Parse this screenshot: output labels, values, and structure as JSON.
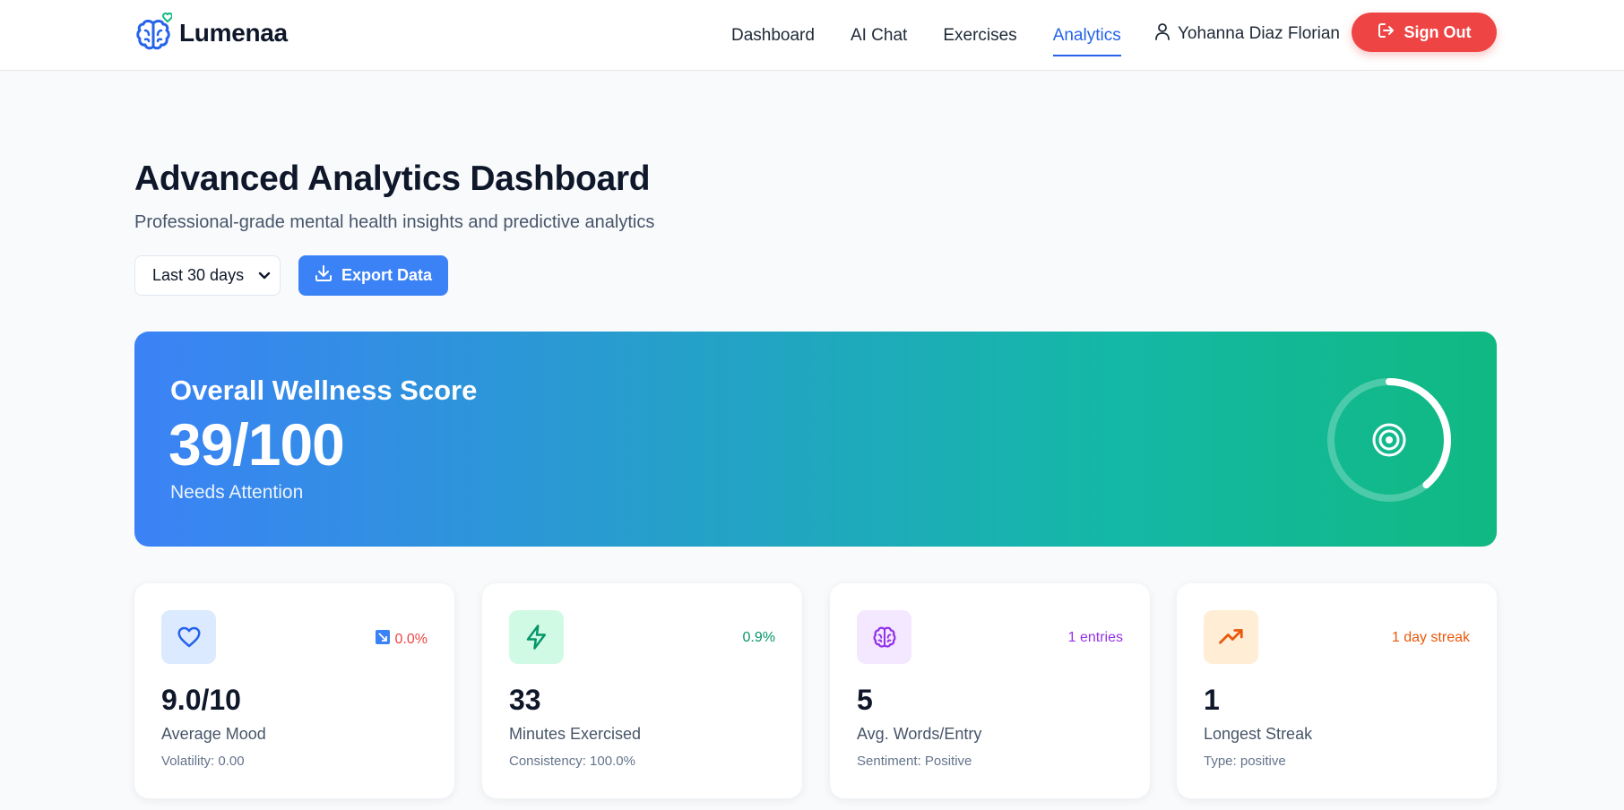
{
  "nav": {
    "brand": "Lumenaa",
    "links": [
      "Dashboard",
      "AI Chat",
      "Exercises",
      "Analytics"
    ],
    "active": "Analytics",
    "user": "Yohanna Diaz Florian",
    "signout": "Sign Out"
  },
  "header": {
    "title": "Advanced Analytics Dashboard",
    "subtitle": "Professional-grade mental health insights and predictive analytics",
    "range": "Last 30 days",
    "export": "Export Data"
  },
  "wellness": {
    "label": "Overall Wellness Score",
    "score": "39/100",
    "status": "Needs Attention",
    "progress": 0.39
  },
  "colors": {
    "accent": "#2563eb",
    "danger": "#ef4444",
    "gradient_start": "#3b82f6",
    "gradient_end": "#10b981"
  },
  "cards": [
    {
      "icon": "heart-icon",
      "badge": "0.0%",
      "badge_icon": "trend-down-icon",
      "badge_color": "#ef4444",
      "value": "9.0/10",
      "label": "Average Mood",
      "sub": "Volatility: 0.00"
    },
    {
      "icon": "lightning-icon",
      "badge": "0.9%",
      "badge_color": "#059669",
      "value": "33",
      "label": "Minutes Exercised",
      "sub": "Consistency: 100.0%"
    },
    {
      "icon": "brain-icon",
      "badge": "1 entries",
      "badge_color": "#9333ea",
      "value": "5",
      "label": "Avg. Words/Entry",
      "sub": "Sentiment: Positive"
    },
    {
      "icon": "trending-up-icon",
      "badge": "1 day streak",
      "badge_color": "#ea580c",
      "value": "1",
      "label": "Longest Streak",
      "sub": "Type: positive"
    }
  ]
}
